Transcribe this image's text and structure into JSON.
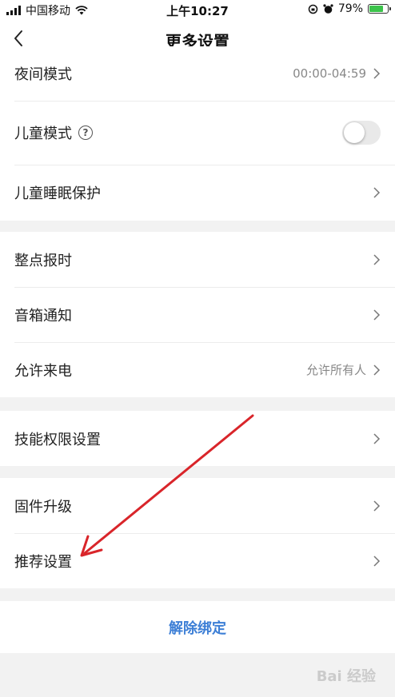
{
  "status_bar": {
    "carrier": "中国移动",
    "time": "上午10:27",
    "battery": "79%",
    "battery_level": 0.79
  },
  "nav": {
    "title": "更多设置",
    "back_icon": "chevron-left-icon"
  },
  "sections": [
    {
      "items": [
        {
          "label": "夜间模式",
          "value": "00:00-04:59"
        },
        {
          "label": "儿童模式",
          "help": "?",
          "toggle_on": false
        },
        {
          "label": "儿童睡眠保护"
        }
      ]
    },
    {
      "items": [
        {
          "label": "整点报时"
        },
        {
          "label": "音箱通知"
        },
        {
          "label": "允许来电",
          "value": "允许所有人"
        }
      ]
    },
    {
      "items": [
        {
          "label": "技能权限设置"
        }
      ]
    },
    {
      "items": [
        {
          "label": "固件升级"
        },
        {
          "label": "推荐设置"
        }
      ]
    }
  ],
  "unbind_label": "解除绑定",
  "colors": {
    "accent": "#3d7fd6",
    "annotation_arrow": "#d9252a",
    "battery_fill": "#3cc34b"
  },
  "watermark": "Bai 经验"
}
